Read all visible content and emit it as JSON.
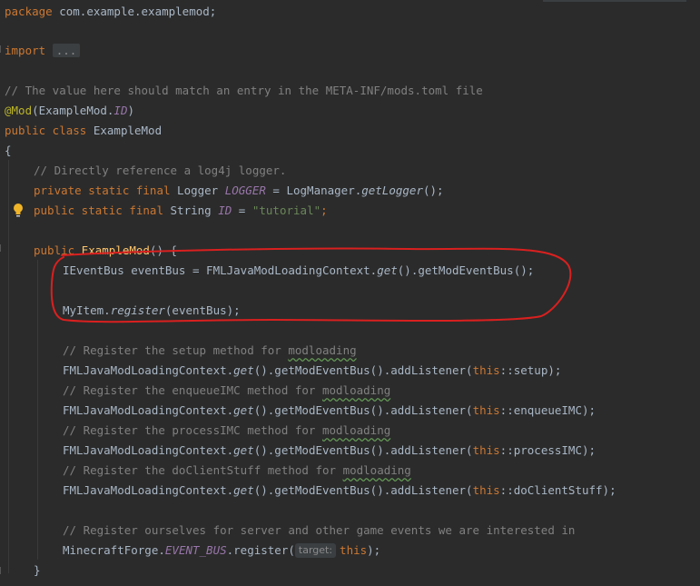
{
  "code": {
    "package_kw": "package",
    "package_name": " com.example.examplemod;",
    "import_kw": "import",
    "import_fold": "...",
    "comment_meta": "// The value here should match an entry in the META-INF/mods.toml file",
    "annotation": "@Mod",
    "annotation_open": "(ExampleMod.",
    "annotation_id": "ID",
    "annotation_close": ")",
    "class_mods": "public class",
    "class_name": " ExampleMod",
    "open_brace": "{",
    "comment_logger": "// Directly reference a log4j logger.",
    "logger_mods": "private static final",
    "logger_type": " Logger ",
    "logger_name": "LOGGER",
    "logger_eq": " = LogManager.",
    "logger_call": "getLogger",
    "logger_end": "();",
    "id_mods": "public static final",
    "id_type": " String ",
    "id_name": "ID",
    "id_eq": " = ",
    "id_value": "\"tutorial\"",
    "id_end": ";",
    "ctor_kw": "public",
    "ctor_name": "ExampleMod",
    "ctor_rest": "() {",
    "eventbus_start": "IEventBus eventBus = FMLJavaModLoadingContext.",
    "eventbus_get": "get",
    "eventbus_end": "().getModEventBus();",
    "myitem_start": "MyItem.",
    "myitem_call": "register",
    "myitem_end": "(eventBus);",
    "comment_setup_a": "// Register the setup method for ",
    "comment_setup_b": "modloading",
    "listener_start": "FMLJavaModLoadingContext.",
    "listener_get": "get",
    "listener_mid": "().getModEventBus().addListener(",
    "this_kw": "this",
    "setup_ref": "::setup);",
    "comment_enqueue_a": "// Register the enqueueIMC method for ",
    "comment_enqueue_b": "modloading",
    "enqueue_ref": "::enqueueIMC);",
    "comment_process_a": "// Register the processIMC method for ",
    "comment_process_b": "modloading",
    "process_ref": "::processIMC);",
    "comment_client_a": "// Register the doClientStuff method for ",
    "comment_client_b": "modloading",
    "client_ref": "::doClientStuff);",
    "comment_register": "// Register ourselves for server and other game events we are interested in",
    "forge_start": "MinecraftForge.",
    "forge_bus": "EVENT_BUS",
    "forge_register": ".register(",
    "param_hint": "target:",
    "forge_end": ");",
    "close_brace": "}"
  },
  "colors": {
    "background": "#2b2b2b",
    "keyword": "#cc7832",
    "comment": "#808080",
    "annotation": "#bbb529",
    "string": "#6a8759",
    "static_field": "#9876aa",
    "method_decl": "#ffc66d",
    "highlight_circle": "#d9201f"
  },
  "icons": [
    "intention-bulb-icon"
  ]
}
